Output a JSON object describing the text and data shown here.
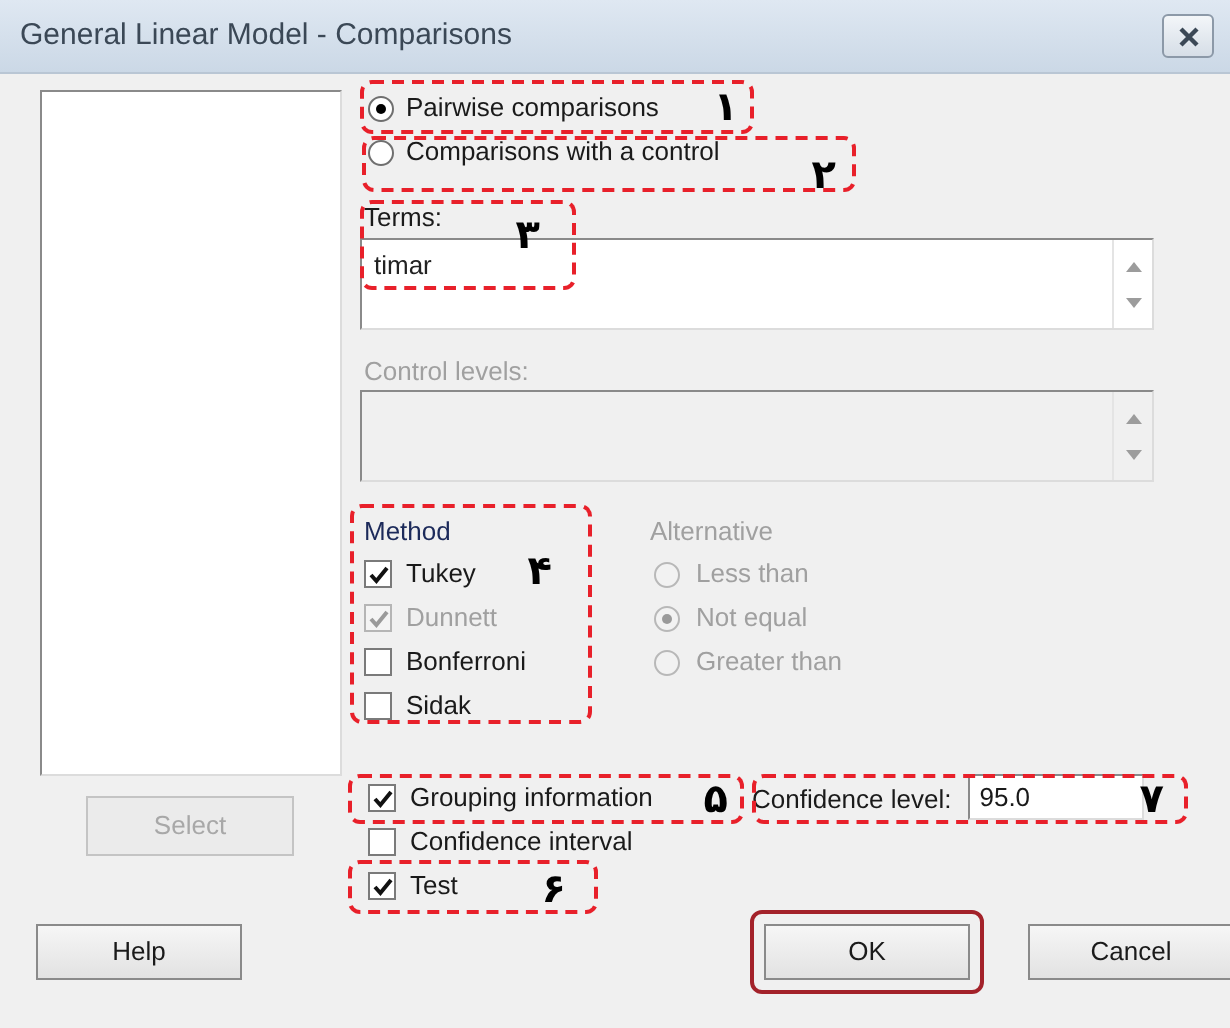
{
  "window": {
    "title": "General Linear Model - Comparisons"
  },
  "comparison_type": [
    {
      "label": "Pairwise comparisons",
      "selected": true
    },
    {
      "label": "Comparisons with a control",
      "selected": false
    }
  ],
  "terms": {
    "label": "Terms:",
    "value": "timar"
  },
  "control_levels": {
    "label": "Control levels:",
    "disabled": true
  },
  "method": {
    "label": "Method",
    "items": [
      {
        "label": "Tukey",
        "checked": true,
        "disabled": false
      },
      {
        "label": "Dunnett",
        "checked": true,
        "disabled": true
      },
      {
        "label": "Bonferroni",
        "checked": false,
        "disabled": false
      },
      {
        "label": "Sidak",
        "checked": false,
        "disabled": false
      }
    ]
  },
  "alternative": {
    "label": "Alternative",
    "disabled": true,
    "options": [
      {
        "label": "Less than",
        "selected": false
      },
      {
        "label": "Not equal",
        "selected": true
      },
      {
        "label": "Greater than",
        "selected": false
      }
    ]
  },
  "select_button": {
    "label": "Select",
    "disabled": true
  },
  "display": [
    {
      "label": "Grouping information",
      "checked": true
    },
    {
      "label": "Confidence interval",
      "checked": false
    },
    {
      "label": "Test",
      "checked": true
    }
  ],
  "confidence_level": {
    "label": "Confidence level:",
    "value": "95.0"
  },
  "buttons": [
    {
      "label": "Help",
      "highlighted": false
    },
    {
      "label": "OK",
      "highlighted": true
    },
    {
      "label": "Cancel",
      "highlighted": false
    }
  ],
  "annotations": [
    {
      "number": "۱"
    },
    {
      "number": "۲"
    },
    {
      "number": "۳"
    },
    {
      "number": "۴"
    },
    {
      "number": "۵"
    },
    {
      "number": "۶"
    },
    {
      "number": "۷"
    }
  ]
}
